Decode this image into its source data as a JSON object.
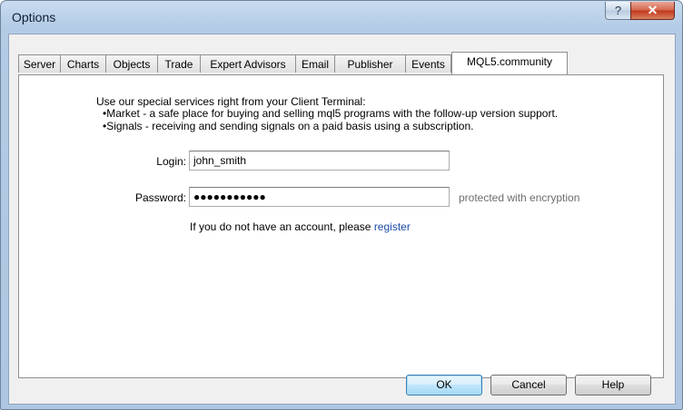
{
  "window": {
    "title": "Options",
    "help_glyph": "?",
    "close_glyph": "✕"
  },
  "tabs": [
    {
      "label": "Server"
    },
    {
      "label": "Charts"
    },
    {
      "label": "Objects"
    },
    {
      "label": "Trade"
    },
    {
      "label": "Expert Advisors"
    },
    {
      "label": "Email"
    },
    {
      "label": "Publisher"
    },
    {
      "label": "Events"
    },
    {
      "label": "MQL5.community",
      "active": true
    }
  ],
  "panel": {
    "intro": "Use our special services right from your Client Terminal:",
    "bullets": [
      "•Market - a safe place for buying and selling mql5 programs with the follow-up version support.",
      "•Signals - receiving and sending signals on a paid basis using a subscription."
    ],
    "login_label": "Login:",
    "login_value": "john_smith",
    "password_label": "Password:",
    "password_value": "●●●●●●●●●●●",
    "password_note": "protected with encryption",
    "register_prefix": "If you do not have an account, please ",
    "register_link": "register"
  },
  "buttons": {
    "ok": "OK",
    "cancel": "Cancel",
    "help": "Help"
  }
}
